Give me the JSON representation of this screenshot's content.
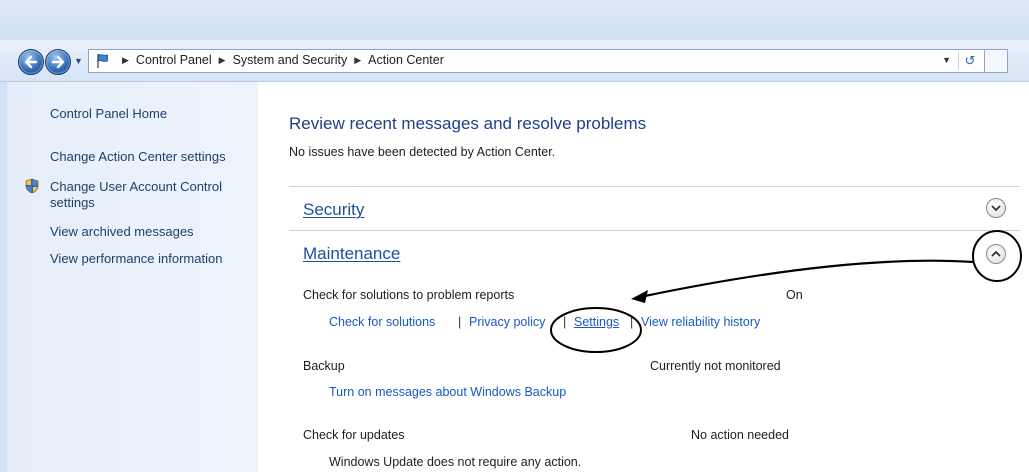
{
  "breadcrumb": {
    "items": [
      "Control Panel",
      "System and Security",
      "Action Center"
    ]
  },
  "sidebar": {
    "home": "Control Panel Home",
    "links": [
      "Change Action Center settings",
      "Change User Account Control settings",
      "View archived messages",
      "View performance information"
    ]
  },
  "main": {
    "title": "Review recent messages and resolve problems",
    "subtitle": "No issues have been detected by Action Center.",
    "security_label": "Security",
    "maintenance_label": "Maintenance",
    "problem_reports": {
      "name": "Check for solutions to problem reports",
      "status": "On",
      "links": [
        "Check for solutions",
        "Privacy policy",
        "Settings",
        "View reliability history"
      ]
    },
    "backup": {
      "name": "Backup",
      "status": "Currently not monitored",
      "link": "Turn on messages about Windows Backup"
    },
    "updates": {
      "name": "Check for updates",
      "status": "No action needed",
      "detail": "Windows Update does not require any action."
    }
  },
  "icons": {
    "back": "back-arrow-icon",
    "forward": "forward-arrow-icon",
    "flag": "action-center-flag-icon",
    "refresh": "refresh-icon",
    "shield": "uac-shield-icon",
    "expand": "chevron-down-icon",
    "collapse": "chevron-up-icon"
  },
  "colors": {
    "link": "#1a58c6",
    "heading": "#1e3f8a",
    "sidebar_bg": "#e4eefa"
  }
}
